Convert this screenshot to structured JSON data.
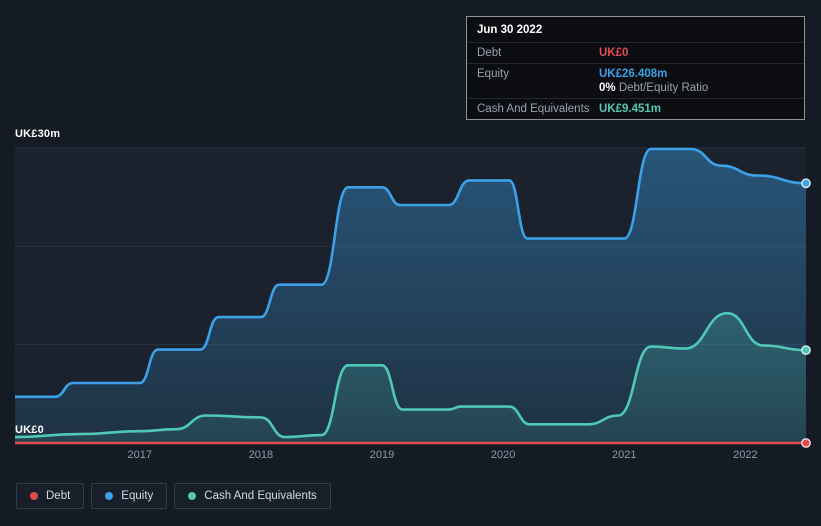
{
  "tooltip": {
    "date": "Jun 30 2022",
    "rows": [
      {
        "label": "Debt",
        "value": "UK£0"
      },
      {
        "label": "Equity",
        "value": "UK£26.408m"
      },
      {
        "label": "Cash And Equivalents",
        "value": "UK£9.451m"
      }
    ],
    "ratio_bold": "0%",
    "ratio_rest": " Debt/Equity Ratio"
  },
  "legend": {
    "items": [
      {
        "label": "Debt",
        "color": "#e6494f"
      },
      {
        "label": "Equity",
        "color": "#3ba1e8"
      },
      {
        "label": "Cash And Equivalents",
        "color": "#50c8b6"
      }
    ]
  },
  "colors": {
    "page_background": "#151b24",
    "plot_band": "#1b222d",
    "gridline": "#2a3240",
    "axis_text": "#8e99a8"
  },
  "chart_data": {
    "type": "area",
    "title": "",
    "y_top_label": "UK£30m",
    "y_bottom_label": "UK£0",
    "y_unit": "UK£ millions",
    "x_range": [
      2015.97,
      2022.5
    ],
    "y_range": [
      0,
      30
    ],
    "gridlines_y": [
      0,
      10,
      20,
      30
    ],
    "x_ticks": [
      "2017",
      "2018",
      "2019",
      "2020",
      "2021",
      "2022"
    ],
    "x_tick_values": [
      2017,
      2018,
      2019,
      2020,
      2021,
      2022
    ],
    "legend_position": "bottom-left",
    "series": [
      {
        "name": "Equity",
        "color": "#3ba1e8",
        "fill": true,
        "end_value": 26.408,
        "points": [
          [
            2015.97,
            4.7
          ],
          [
            2016.3,
            4.7
          ],
          [
            2016.45,
            6.1
          ],
          [
            2017.0,
            6.1
          ],
          [
            2017.15,
            9.5
          ],
          [
            2017.5,
            9.5
          ],
          [
            2017.65,
            12.8
          ],
          [
            2018.0,
            12.8
          ],
          [
            2018.15,
            16.1
          ],
          [
            2018.5,
            16.1
          ],
          [
            2018.72,
            26.0
          ],
          [
            2019.0,
            26.0
          ],
          [
            2019.15,
            24.2
          ],
          [
            2019.55,
            24.2
          ],
          [
            2019.72,
            26.7
          ],
          [
            2020.05,
            26.7
          ],
          [
            2020.2,
            20.8
          ],
          [
            2021.0,
            20.8
          ],
          [
            2021.22,
            29.9
          ],
          [
            2021.55,
            29.9
          ],
          [
            2021.8,
            28.2
          ],
          [
            2022.1,
            27.2
          ],
          [
            2022.5,
            26.408
          ]
        ]
      },
      {
        "name": "Cash And Equivalents",
        "color": "#50c8b6",
        "fill": true,
        "end_value": 9.451,
        "points": [
          [
            2015.97,
            0.6
          ],
          [
            2016.5,
            0.9
          ],
          [
            2017.0,
            1.2
          ],
          [
            2017.3,
            1.4
          ],
          [
            2017.55,
            2.8
          ],
          [
            2018.0,
            2.6
          ],
          [
            2018.2,
            0.6
          ],
          [
            2018.5,
            0.8
          ],
          [
            2018.72,
            7.9
          ],
          [
            2019.0,
            7.9
          ],
          [
            2019.17,
            3.4
          ],
          [
            2019.55,
            3.4
          ],
          [
            2019.65,
            3.7
          ],
          [
            2020.05,
            3.7
          ],
          [
            2020.22,
            1.9
          ],
          [
            2020.7,
            1.9
          ],
          [
            2020.95,
            2.8
          ],
          [
            2021.22,
            9.8
          ],
          [
            2021.5,
            9.6
          ],
          [
            2021.85,
            13.2
          ],
          [
            2022.15,
            9.9
          ],
          [
            2022.5,
            9.451
          ]
        ]
      },
      {
        "name": "Debt",
        "color": "#e6494f",
        "fill": false,
        "end_value": 0,
        "points": [
          [
            2015.97,
            0
          ],
          [
            2022.5,
            0
          ]
        ]
      }
    ]
  }
}
